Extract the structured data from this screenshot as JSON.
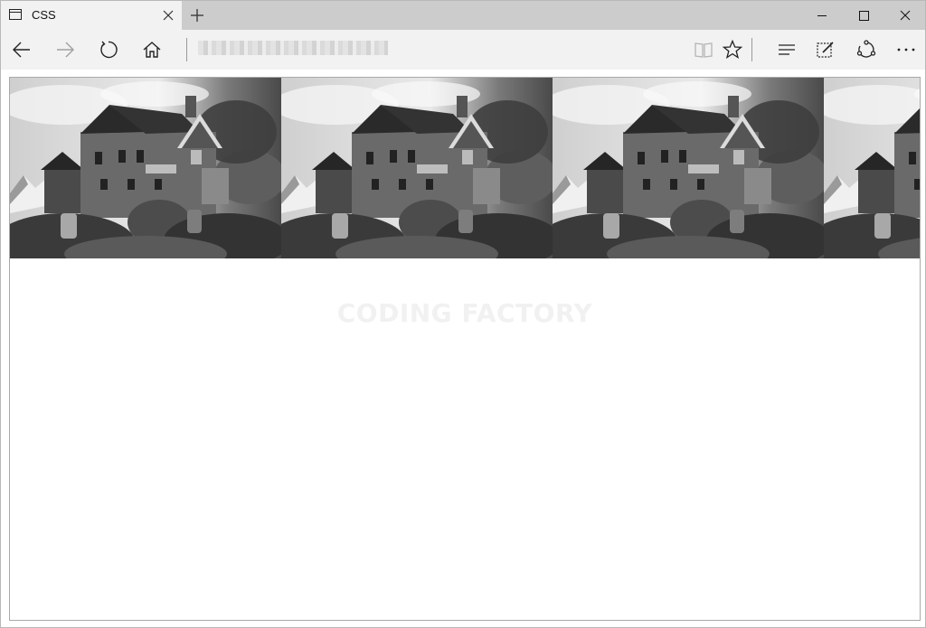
{
  "tab": {
    "title": "CSS"
  },
  "icons": {
    "tab": "browser-tab-icon",
    "tab_close": "close-icon",
    "new_tab": "plus-icon",
    "back": "arrow-left-icon",
    "forward": "arrow-right-icon",
    "refresh": "refresh-icon",
    "home": "home-icon",
    "reading_view": "book-icon",
    "favorite": "star-icon",
    "hub": "hub-icon",
    "notes": "pen-note-icon",
    "share": "share-icon",
    "more": "more-icon",
    "minimize": "minimize-icon",
    "maximize": "maximize-icon",
    "close": "close-icon"
  },
  "page": {
    "watermark": "CODING FACTORY",
    "banner_image": "grayscale house photo repeated horizontally"
  },
  "colors": {
    "titlebar": "#cccccc",
    "toolbar": "#f2f2f2",
    "content_border": "#a9a9a9"
  }
}
